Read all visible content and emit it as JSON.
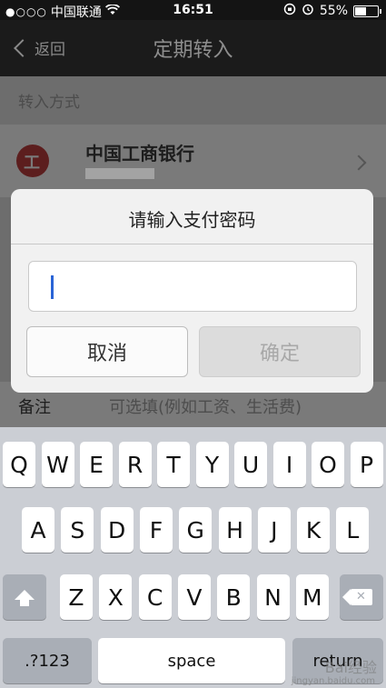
{
  "status_bar": {
    "signal": "●○○○",
    "carrier": "中国联通",
    "time": "16:51",
    "battery": "55%",
    "battery_level": 0.55
  },
  "nav": {
    "back_label": "返回",
    "title": "定期转入"
  },
  "page": {
    "section_label": "转入方式",
    "bank_name": "中国工商银行",
    "remark_label": "备注",
    "remark_placeholder": "可选填(例如工资、生活费)"
  },
  "dialog": {
    "title": "请输入支付密码",
    "cancel_label": "取消",
    "confirm_label": "确定"
  },
  "keyboard": {
    "row1": [
      "Q",
      "W",
      "E",
      "R",
      "T",
      "Y",
      "U",
      "I",
      "O",
      "P"
    ],
    "row2": [
      "A",
      "S",
      "D",
      "F",
      "G",
      "H",
      "J",
      "K",
      "L"
    ],
    "row3": [
      "Z",
      "X",
      "C",
      "V",
      "B",
      "N",
      "M"
    ],
    "numbers_label": ".?123",
    "space_label": "space",
    "return_label": "return"
  },
  "watermark": {
    "text": "Bai经验",
    "url": "jingyan.baidu.com"
  },
  "colors": {
    "caret": "#2a64d6",
    "bank_logo": "#c0262b"
  }
}
